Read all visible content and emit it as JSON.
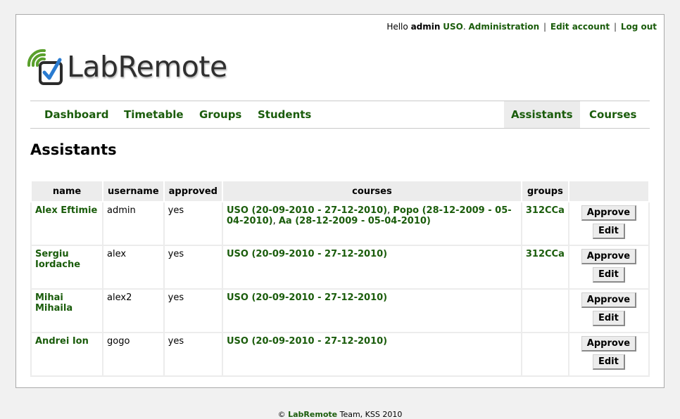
{
  "userbar": {
    "greeting": "Hello",
    "username": "admin",
    "course": "USO",
    "administration": "Administration",
    "edit_account": "Edit account",
    "logout": "Log out"
  },
  "logo": {
    "text": "LabRemote"
  },
  "nav": {
    "dashboard": "Dashboard",
    "timetable": "Timetable",
    "groups": "Groups",
    "students": "Students",
    "assistants": "Assistants",
    "courses": "Courses"
  },
  "page_title": "Assistants",
  "table": {
    "headers": [
      "name",
      "username",
      "approved",
      "courses",
      "groups",
      ""
    ],
    "rows": [
      {
        "name": "Alex Eftimie",
        "username": "admin",
        "approved": "yes",
        "courses": [
          "USO (20-09-2010 - 27-12-2010)",
          "Popo (28-12-2009 - 05-04-2010)",
          "Aa (28-12-2009 - 05-04-2010)"
        ],
        "groups": "312CCa"
      },
      {
        "name": "Sergiu Iordache",
        "username": "alex",
        "approved": "yes",
        "courses": [
          "USO (20-09-2010 - 27-12-2010)"
        ],
        "groups": "312CCa"
      },
      {
        "name": "Mihai Mihaila",
        "username": "alex2",
        "approved": "yes",
        "courses": [
          "USO (20-09-2010 - 27-12-2010)"
        ],
        "groups": ""
      },
      {
        "name": "Andrei Ion",
        "username": "gogo",
        "approved": "yes",
        "courses": [
          "USO (20-09-2010 - 27-12-2010)"
        ],
        "groups": ""
      }
    ],
    "approve_label": "Approve",
    "edit_label": "Edit"
  },
  "footer": {
    "copyright": "©",
    "brand": "LabRemote",
    "suffix": "Team, KSS 2010"
  },
  "colors": {
    "link": "#1a5c0b",
    "logo_green": "#5aa02c",
    "logo_blue": "#2a7bd0"
  },
  "icons": {
    "logo": "checkbox-signal-icon"
  }
}
